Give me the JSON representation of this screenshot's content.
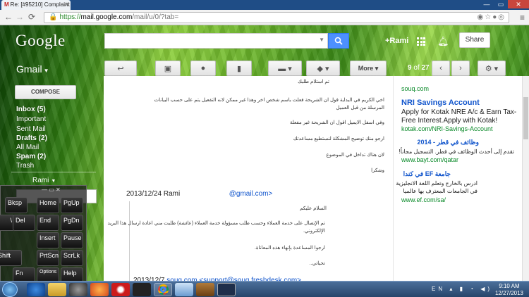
{
  "browser": {
    "tab_title": "Re: [#95210] Complaint b",
    "tab_close": "x",
    "url_https": "https://",
    "url_host": "mail.google.com",
    "url_path": "/mail/u/0/?tab=",
    "window_buttons": [
      "—",
      "▭",
      "✕"
    ]
  },
  "header": {
    "logo": "Google",
    "user": "+Rami",
    "share": "Share",
    "app_label": "Gmail"
  },
  "toolbar": {
    "more_label": "More",
    "page_info_current": "9",
    "page_info_of": "of",
    "page_info_total": "27"
  },
  "sidebar": {
    "compose": "COMPOSE",
    "items": [
      {
        "label": "Inbox (5)"
      },
      {
        "label": "Important"
      },
      {
        "label": "Sent Mail"
      },
      {
        "label": "Drafts (2)"
      },
      {
        "label": "All Mail"
      },
      {
        "label": "Spam (2)"
      },
      {
        "label": "Trash"
      }
    ],
    "chat_user": "Rami"
  },
  "mail": {
    "lines": [
      "تم استلام طلبك",
      "اخي الكريم في البداية قول ان الشريحة فعلت باسم شخص اخر وهذا غير ممكن لانه  التفعيل يتم على حسب البيانات",
      "المرسلة من قبل العميل",
      "وفي اسفل الايميل اقول ان الشريحة غير مفعلة",
      "ارجو منك توضيح المشكلة لنستطيع مساعدتك",
      "لان هناك تداخل في الموضوع",
      "وشكرا"
    ],
    "quoted_date": "2013/12/24",
    "quoted_name": "Rami",
    "quoted_email": "@gmail.com>",
    "quoted_lines": [
      "السلام عليكم",
      "تم الإتصال على خدمة العملاء وحسب طلب مسؤولة خدمة العملاء (عائشة) طلبت مني اعادة ارسال هذا البريد",
      "الإلكتروني.",
      "ارجوا المساعدة بإنهاء هذه المعاناة.",
      "تحياتي.."
    ],
    "older_date": "2013/12/7",
    "older_from": "souq.com <support@souq.freshdesk.com>"
  },
  "ads": {
    "top_url_partial": "souq.com",
    "ad1_title": "NRI Savings Account",
    "ad1_body_1": "Apply for Kotak NRE A/c & Earn Tax-",
    "ad1_body_2": "Free Interest.Apply with Kotak!",
    "ad1_url": "kotak.com/NRI-Savings-Account",
    "ad2_title": "وظائف في قطر - 2014",
    "ad2_body": "تقدم إلى أحدث الوظائف في قطر. التسجيل مجاناً!",
    "ad2_url": "www.bayt.com/qatar",
    "ad3_title": "جامعة EF في كندا",
    "ad3_body_1": "ادرس بالخارج وتعلم اللغة الانجليزية",
    "ad3_body_2": "في الجامعات المعترف بها عالميا",
    "ad3_url": "www.ef.com/sa/"
  },
  "keyboard": {
    "keys": [
      "Bksp",
      "Home",
      "PgUp",
      "\\",
      "Del",
      "End",
      "PgDn",
      "Insert",
      "Pause",
      "Shift",
      "PrtScn",
      "ScrLk",
      "Fn",
      "Options",
      "Help"
    ]
  },
  "taskbar": {
    "lang": "EN",
    "time": "9:10 AM",
    "date": "12/27/2013"
  },
  "colors": {
    "link": "#1155cc",
    "ad_url": "#0b8a2a",
    "search_button": "#4d90fe"
  }
}
